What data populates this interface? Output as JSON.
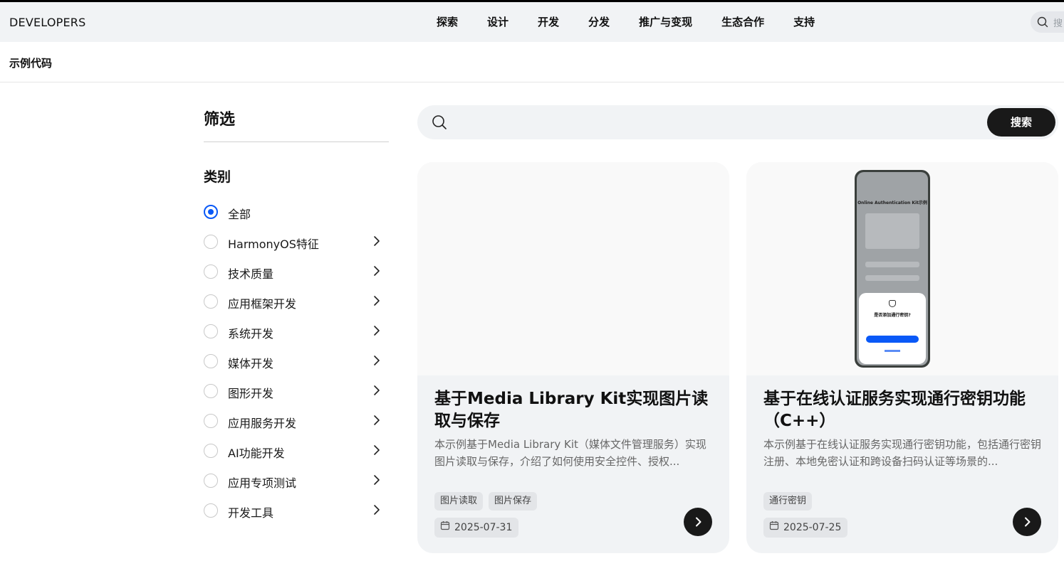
{
  "header": {
    "brand": "DEVELOPERS",
    "nav": [
      "探索",
      "设计",
      "开发",
      "分发",
      "推广与变现",
      "生态合作",
      "支持"
    ],
    "search_placeholder": "搜"
  },
  "subheader": {
    "title": "示例代码"
  },
  "filter": {
    "title": "筛选",
    "category_title": "类别",
    "items": [
      {
        "label": "全部",
        "checked": true
      },
      {
        "label": "HarmonyOS特征"
      },
      {
        "label": "技术质量"
      },
      {
        "label": "应用框架开发"
      },
      {
        "label": "系统开发"
      },
      {
        "label": "媒体开发"
      },
      {
        "label": "图形开发"
      },
      {
        "label": "应用服务开发"
      },
      {
        "label": "AI功能开发"
      },
      {
        "label": "应用专项测试"
      },
      {
        "label": "开发工具"
      }
    ]
  },
  "search": {
    "button": "搜索"
  },
  "cards": [
    {
      "title": "基于Media Library Kit实现图片读取与保存",
      "desc": "本示例基于Media Library Kit（媒体文件管理服务）实现图片读取与保存，介绍了如何使用安全控件、授权...",
      "tags": [
        "图片读取",
        "图片保存"
      ],
      "date": "2025-07-31"
    },
    {
      "title": "基于在线认证服务实现通行密钥功能（C++）",
      "desc": "本示例基于在线认证服务实现通行密钥功能，包括通行密钥注册、本地免密认证和跨设备扫码认证等场景的...",
      "tags": [
        "通行密钥"
      ],
      "date": "2025-07-25",
      "screenshot": {
        "app_title": "Online Authentication Kit示例",
        "dialog_title": "是否添加通行密钥?"
      }
    }
  ],
  "colors": {
    "accent": "#0a59f7",
    "dark": "#191919",
    "panel": "#f1f3f5"
  }
}
